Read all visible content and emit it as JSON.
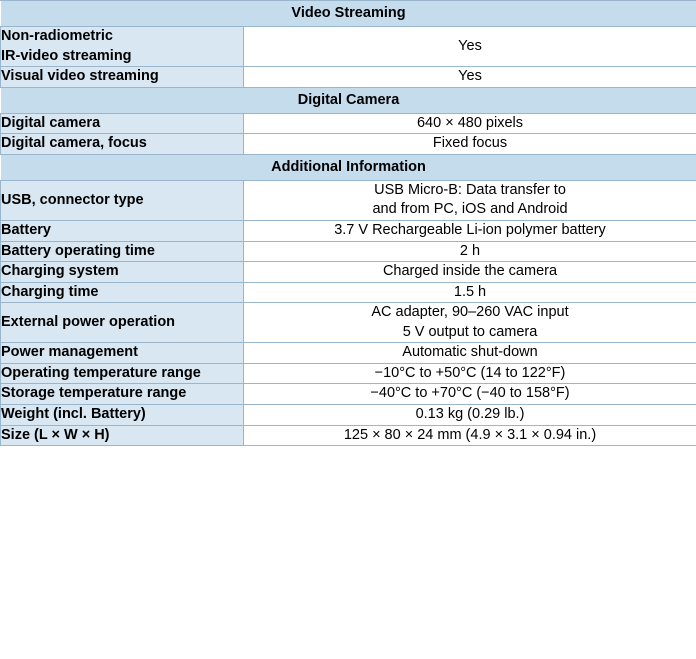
{
  "table": {
    "sections": [
      {
        "title": "Video Streaming",
        "rows": [
          {
            "label": [
              "Non-radiometric",
              "IR-video streaming"
            ],
            "value": [
              "Yes"
            ]
          },
          {
            "label": [
              "Visual video streaming"
            ],
            "value": [
              "Yes"
            ]
          }
        ]
      },
      {
        "title": "Digital Camera",
        "rows": [
          {
            "label": [
              "Digital camera"
            ],
            "value": [
              "640 × 480 pixels"
            ]
          },
          {
            "label": [
              "Digital camera, focus"
            ],
            "value": [
              "Fixed focus"
            ]
          }
        ]
      },
      {
        "title": "Additional Information",
        "rows": [
          {
            "label": [
              "USB, connector type"
            ],
            "value": [
              "USB Micro-B: Data transfer to",
              "and from PC, iOS and Android"
            ]
          },
          {
            "label": [
              "Battery"
            ],
            "value": [
              "3.7 V Rechargeable Li-ion polymer battery"
            ]
          },
          {
            "label": [
              "Battery operating time"
            ],
            "value": [
              "2 h"
            ]
          },
          {
            "label": [
              "Charging system"
            ],
            "value": [
              "Charged inside the camera"
            ]
          },
          {
            "label": [
              "Charging time"
            ],
            "value": [
              "1.5 h"
            ]
          },
          {
            "label": [
              "External power operation"
            ],
            "value": [
              "AC adapter, 90–260 VAC input",
              "5 V output to camera"
            ]
          },
          {
            "label": [
              "Power management"
            ],
            "value": [
              "Automatic shut-down"
            ]
          },
          {
            "label": [
              "Operating temperature range"
            ],
            "value": [
              "−10°C to +50°C (14 to 122°F)"
            ]
          },
          {
            "label": [
              "Storage temperature range"
            ],
            "value": [
              "−40°C to +70°C (−40 to 158°F)"
            ]
          },
          {
            "label": [
              "Weight (incl. Battery)"
            ],
            "value": [
              "0.13 kg (0.29 lb.)"
            ]
          },
          {
            "label": [
              "Size (L × W × H)"
            ],
            "value": [
              "125 × 80 × 24 mm (4.9 × 3.1 × 0.94 in.)"
            ]
          }
        ]
      }
    ]
  }
}
